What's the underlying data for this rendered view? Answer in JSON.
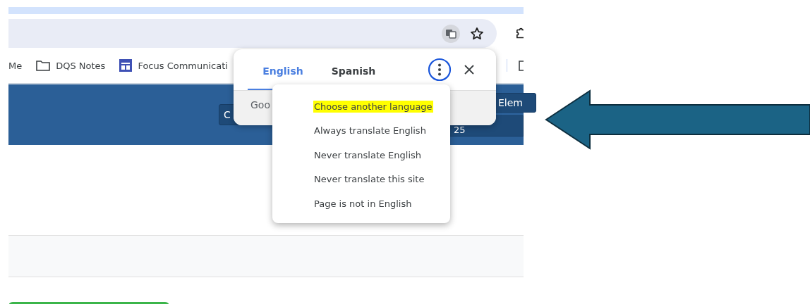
{
  "bookmarks": [
    {
      "label": "Me",
      "kind": "plain"
    },
    {
      "label": "DQS Notes",
      "kind": "folder"
    },
    {
      "label": "Focus Communicati",
      "kind": "app"
    }
  ],
  "header": {
    "left_button": "C",
    "right_button": "Elem",
    "bar_text": "25"
  },
  "translate_popup": {
    "tabs": [
      {
        "label": "English",
        "selected": true
      },
      {
        "label": "Spanish",
        "selected": false
      }
    ],
    "footer_text": "Goo"
  },
  "menu": {
    "items": [
      {
        "label": "Choose another language",
        "selected": true
      },
      {
        "label": "Always translate English",
        "selected": false
      },
      {
        "label": "Never translate English",
        "selected": false
      },
      {
        "label": "Never translate this site",
        "selected": false
      },
      {
        "label": "Page is not in English",
        "selected": false
      }
    ]
  }
}
